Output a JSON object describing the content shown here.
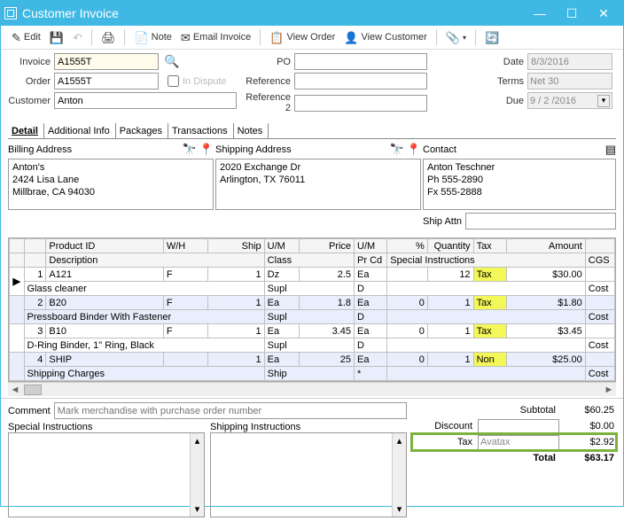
{
  "window": {
    "title": "Customer Invoice"
  },
  "toolbar": {
    "edit": "Edit",
    "note": "Note",
    "email": "Email Invoice",
    "view_order": "View Order",
    "view_customer": "View Customer"
  },
  "form": {
    "invoice_lbl": "Invoice",
    "invoice": "A1555T",
    "order_lbl": "Order",
    "order": "A1555T",
    "customer_lbl": "Customer",
    "customer": "Anton",
    "po_lbl": "PO",
    "po": "",
    "reference_lbl": "Reference",
    "reference": "",
    "reference2_lbl": "Reference 2",
    "reference2": "",
    "in_dispute": "In Dispute",
    "date_lbl": "Date",
    "date": "8/3/2016",
    "terms_lbl": "Terms",
    "terms": "Net 30",
    "due_lbl": "Due",
    "due": "9 / 2 /2016"
  },
  "tabs": [
    "Detail",
    "Additional Info",
    "Packages",
    "Transactions",
    "Notes"
  ],
  "addr": {
    "billing_lbl": "Billing Address",
    "billing": "Anton's\n2424 Lisa Lane\nMillbrae, CA 94030",
    "shipping_lbl": "Shipping Address",
    "shipping": "2020 Exchange Dr\nArlington, TX 76011",
    "contact_lbl": "Contact",
    "contact": "Anton Teschner\nPh 555-2890\nFx 555-2888",
    "ship_attn_lbl": "Ship Attn",
    "ship_attn": ""
  },
  "grid": {
    "hdr1": {
      "c1": "",
      "c2": "",
      "c3": "Product ID",
      "c4": "W/H",
      "c5": "Ship",
      "c6": "U/M",
      "c7": "Price",
      "c8": "U/M",
      "c9": "%",
      "c10": "Quantity",
      "c11": "Tax",
      "c12": "Amount",
      "c13": ""
    },
    "hdr2": {
      "c1": "",
      "c2": "",
      "c3": "Description",
      "c4": "",
      "c5": "",
      "c6": "Class",
      "c7": "",
      "c8": "Pr Cd",
      "c9": "Special Instructions",
      "c10": "",
      "c11": "",
      "c12": "",
      "c13": "CGS"
    },
    "rows": [
      {
        "n": "1",
        "pid": "A121",
        "wh": "F",
        "ship": "1",
        "um1": "Dz",
        "price": "2.5",
        "um2": "Ea",
        "pct": "",
        "qty": "12",
        "tax": "Tax",
        "amt": "$30.00",
        "cgs": ""
      },
      {
        "desc": "Glass cleaner",
        "class": "Supl",
        "prcd": "D",
        "si": "",
        "cgs": "Cost"
      },
      {
        "n": "2",
        "pid": "B20",
        "wh": "F",
        "ship": "1",
        "um1": "Ea",
        "price": "1.8",
        "um2": "Ea",
        "pct": "0",
        "qty": "1",
        "tax": "Tax",
        "amt": "$1.80",
        "cgs": ""
      },
      {
        "desc": "Pressboard Binder With Fastener",
        "class": "Supl",
        "prcd": "D",
        "si": "",
        "cgs": "Cost"
      },
      {
        "n": "3",
        "pid": "B10",
        "wh": "F",
        "ship": "1",
        "um1": "Ea",
        "price": "3.45",
        "um2": "Ea",
        "pct": "0",
        "qty": "1",
        "tax": "Tax",
        "amt": "$3.45",
        "cgs": ""
      },
      {
        "desc": "D-Ring Binder, 1\" Ring, Black",
        "class": "Supl",
        "prcd": "D",
        "si": "",
        "cgs": "Cost"
      },
      {
        "n": "4",
        "pid": "SHIP",
        "wh": "",
        "ship": "1",
        "um1": "Ea",
        "price": "25",
        "um2": "Ea",
        "pct": "0",
        "qty": "1",
        "tax": "Non",
        "amt": "$25.00",
        "cgs": ""
      },
      {
        "desc": "Shipping Charges",
        "class": "Ship",
        "prcd": "*",
        "si": "",
        "cgs": "Cost"
      }
    ]
  },
  "bottom": {
    "comment_lbl": "Comment",
    "comment_ph": "Mark merchandise with purchase order number",
    "special_lbl": "Special Instructions",
    "shipping_lbl": "Shipping Instructions"
  },
  "totals": {
    "subtotal_lbl": "Subtotal",
    "subtotal": "$60.25",
    "discount_lbl": "Discount",
    "discount_in": "",
    "discount": "$0.00",
    "tax_lbl": "Tax",
    "tax_in": "Avatax",
    "tax": "$2.92",
    "total_lbl": "Total",
    "total": "$63.17"
  }
}
